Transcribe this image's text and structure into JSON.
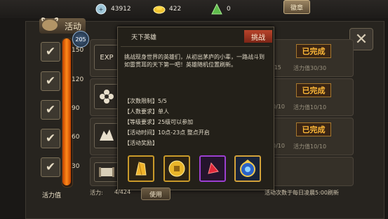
{
  "resources": {
    "silver": "43912",
    "gold": "422",
    "jade": "0"
  },
  "header": {
    "badge_label": "徽章",
    "tab_label": "活动",
    "level_badge": "205",
    "close_label": "✕"
  },
  "gauge": {
    "ticks": [
      "150",
      "120",
      "90",
      "60",
      "30"
    ],
    "label": "活力值",
    "fill_fraction": 1.0
  },
  "rows": [
    {
      "icon": "exp-icon",
      "icon_text": "EXP",
      "fragment": "/15",
      "vitality": "活力值30/30",
      "done": "已完成"
    },
    {
      "icon": "flower-icon",
      "icon_text": "",
      "fragment": "0/10",
      "vitality": "活力值10/10",
      "done": "已完成"
    },
    {
      "icon": "beast-icon",
      "icon_text": "",
      "fragment": "0/10",
      "vitality": "活力值10/10",
      "done": "已完成"
    },
    {
      "icon": "scroll-icon",
      "icon_text": "",
      "fragment": "",
      "vitality": "",
      "done": ""
    }
  ],
  "dialog": {
    "title": "天下英雄",
    "tag": "挑战",
    "description": "挑战现身世界的英雄们，从初出茅庐的小辈，一路战斗到如雷贯耳的天下第一吧！英雄随机位置刷新。",
    "info": [
      "【次数限制】5/5",
      "【人数要求】单人",
      "【等级要求】25级可以参加",
      "【活动时间】10点-23点 整点开启",
      "【活动奖励】"
    ],
    "rewards": [
      {
        "name": "gold-crystal-icon",
        "border": "#c99a2a"
      },
      {
        "name": "gold-coin-icon",
        "border": "#c99a2a"
      },
      {
        "name": "red-gem-icon",
        "border": "#9b3fd0"
      },
      {
        "name": "blue-amulet-icon",
        "border": "#d2a23a"
      }
    ]
  },
  "bottom": {
    "vitality_label": "活力:",
    "vitality_value": "4/424",
    "use_label": "使用",
    "reset_note": "活动次数于每日凌晨5:00刷新"
  },
  "colors": {
    "done": "#ffb938",
    "gauge": "#ff8a1a",
    "tag": "#b8442b"
  }
}
